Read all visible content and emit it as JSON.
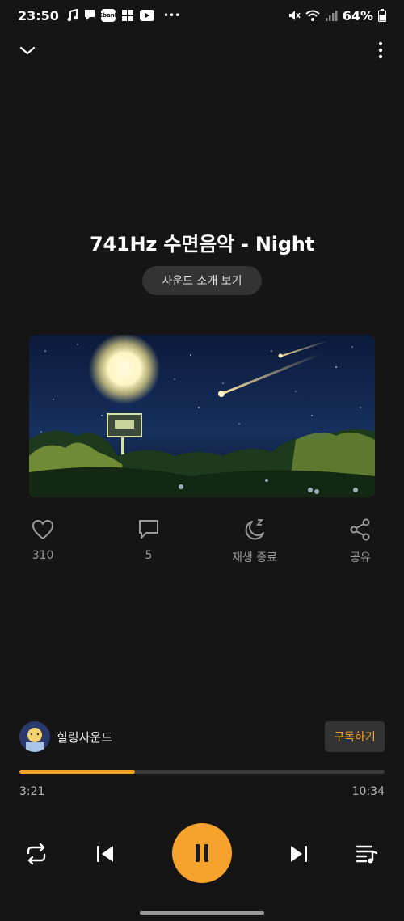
{
  "status": {
    "time": "23:50",
    "kbank_label": "Kbank",
    "battery": "64%"
  },
  "track": {
    "title": "741Hz 수면음악 - Night",
    "intro_label": "사운드 소개 보기"
  },
  "actions": {
    "likes": "310",
    "comments": "5",
    "sleep_timer": "재생 종료",
    "share": "공유"
  },
  "channel": {
    "name": "힐링사운드",
    "subscribe_label": "구독하기"
  },
  "player": {
    "current_time": "3:21",
    "total_time": "10:34",
    "progress_fraction": 0.317,
    "accent_color": "#f6a32e"
  },
  "icons": [
    "collapse-icon",
    "more-icon",
    "heart-icon",
    "comment-icon",
    "moon-icon",
    "share-icon",
    "repeat-icon",
    "previous-icon",
    "pause-icon",
    "next-icon",
    "playlist-icon"
  ]
}
